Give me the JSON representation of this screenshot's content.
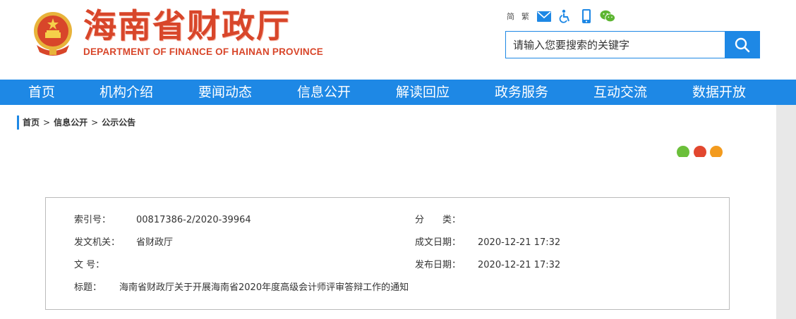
{
  "header": {
    "title": "海南省财政厅",
    "subtitle": "DEPARTMENT OF FINANCE OF HAINAN PROVINCE",
    "links": {
      "simplified": "简",
      "traditional": "繁"
    },
    "icons": [
      "mail-icon",
      "accessibility-icon",
      "mobile-icon",
      "wechat-icon"
    ],
    "search_placeholder": "请输入您要搜索的关键字"
  },
  "nav": {
    "items": [
      "首页",
      "机构介绍",
      "要闻动态",
      "信息公开",
      "解读回应",
      "政务服务",
      "互动交流",
      "数据开放"
    ]
  },
  "breadcrumb": {
    "items": [
      "首页",
      "信息公开",
      "公示公告"
    ],
    "separator": ">"
  },
  "share": [
    "wechat-share-icon",
    "weibo-share-icon",
    "favorite-share-icon"
  ],
  "info": {
    "index_label": "索引号：",
    "index_value": "00817386-2/2020-39964",
    "category_label": "分　　类：",
    "category_value": "",
    "issuer_label": "发文机关：",
    "issuer_value": "省财政厅",
    "created_label": "成文日期：",
    "created_value": "2020-12-21 17:32",
    "docno_label": "文 号：",
    "docno_value": "",
    "published_label": "发布日期：",
    "published_value": "2020-12-21 17:32",
    "title_label": "标题：",
    "title_value": "海南省财政厅关于开展海南省2020年度高级会计师评审答辩工作的通知"
  },
  "colors": {
    "brand_red": "#d8462a",
    "nav_blue": "#1e88e5",
    "share_green": "#6bbf3a",
    "share_red": "#e2472f",
    "share_orange": "#f39b1e"
  }
}
